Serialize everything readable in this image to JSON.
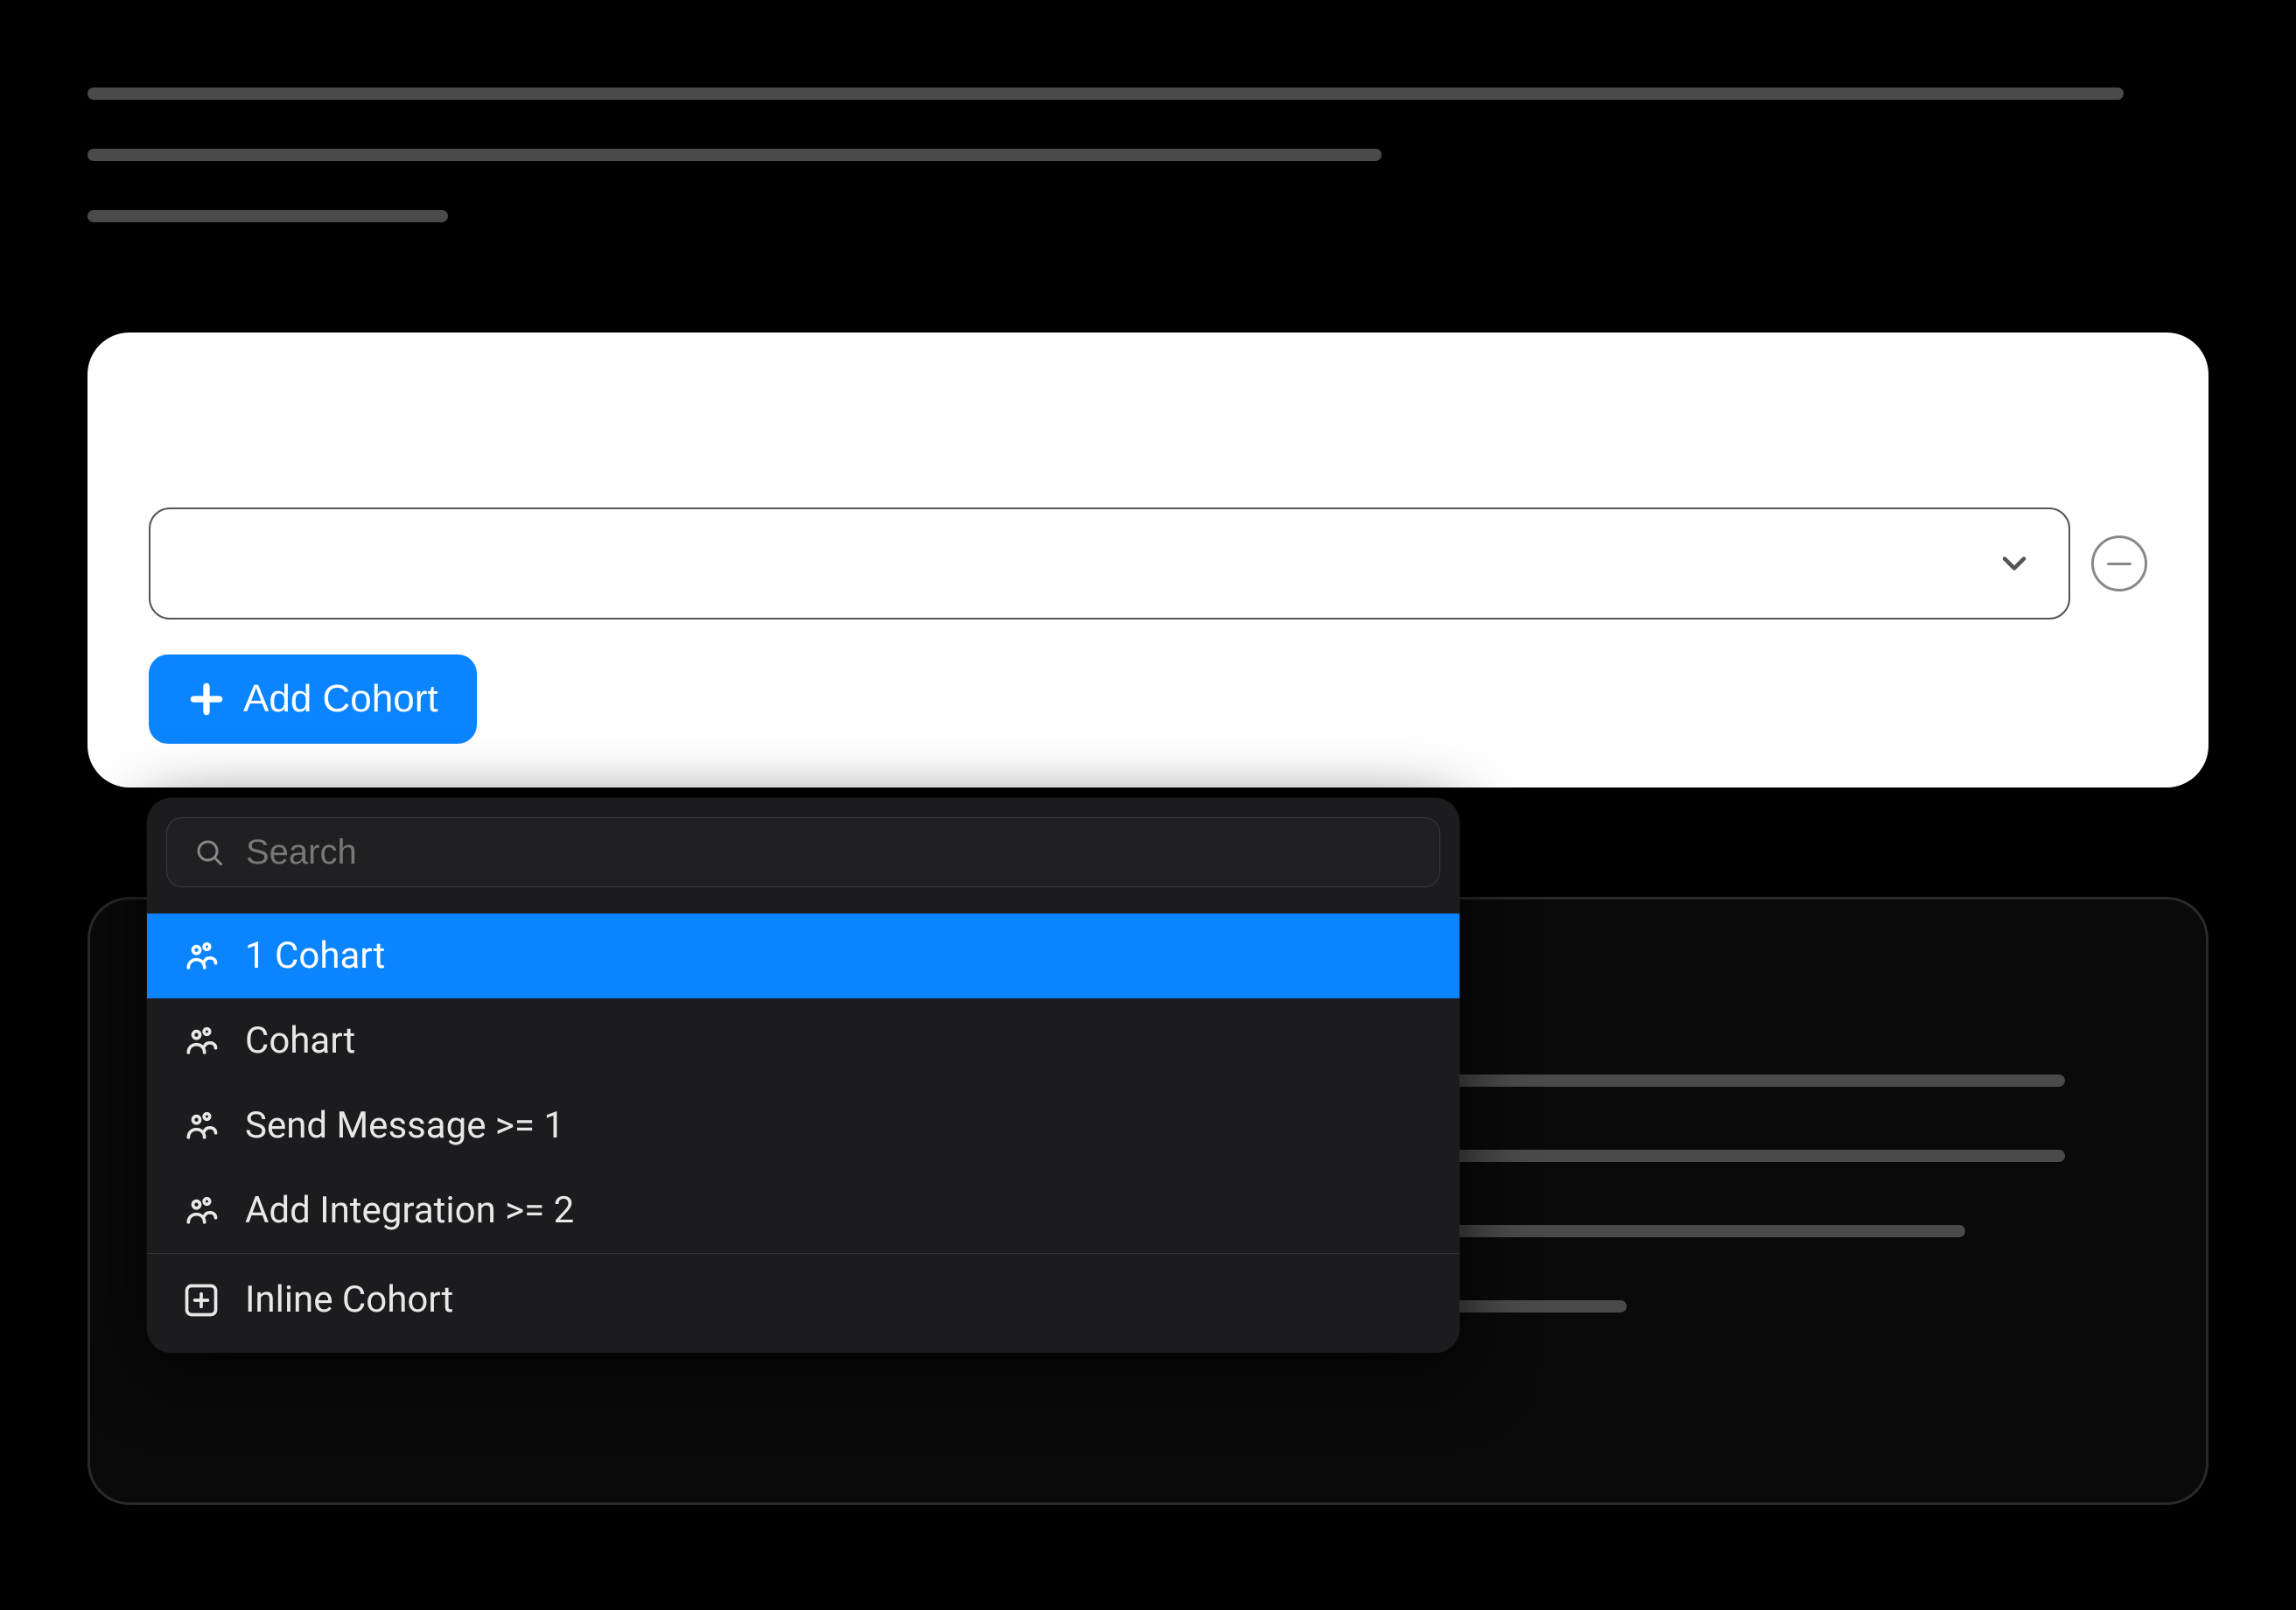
{
  "buttons": {
    "add_cohort_label": "Add Cohort"
  },
  "dropdown": {
    "search_placeholder": "Search",
    "items": [
      {
        "label": "1 Cohart",
        "highlighted": true
      },
      {
        "label": "Cohart",
        "highlighted": false
      },
      {
        "label": "Send Message >= 1",
        "highlighted": false
      },
      {
        "label": "Add Integration >= 2",
        "highlighted": false
      }
    ],
    "inline_cohort_label": "Inline Cohort"
  }
}
